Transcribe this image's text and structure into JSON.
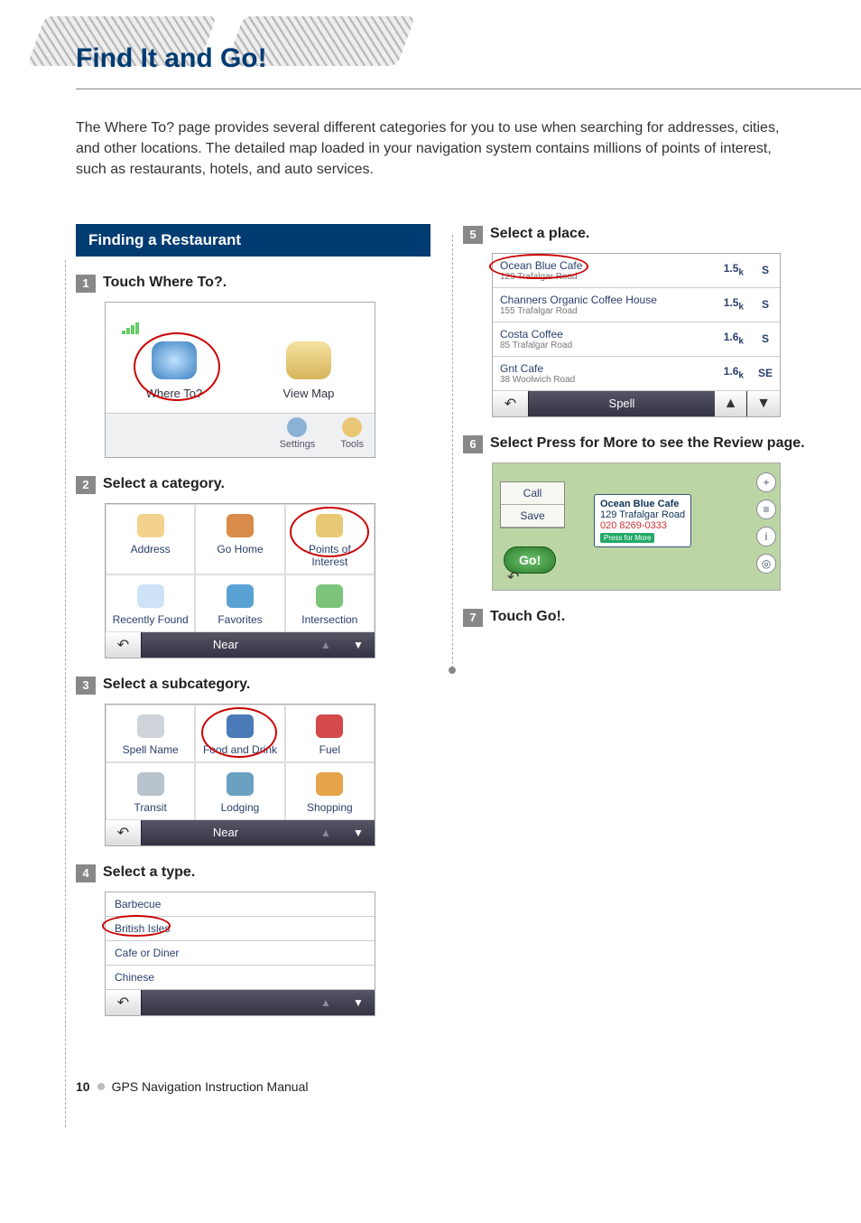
{
  "header": {
    "title": "Find It and Go!"
  },
  "intro": "The Where To? page provides several different categories for you to use when searching for addresses, cities, and other locations. The detailed map loaded in your navigation system contains millions of points of interest, such as restaurants, hotels, and auto services.",
  "left": {
    "section_title": "Finding a Restaurant",
    "steps": [
      {
        "num": "1",
        "text": "Touch Where To?."
      },
      {
        "num": "2",
        "text": "Select a category."
      },
      {
        "num": "3",
        "text": "Select a subcategory."
      },
      {
        "num": "4",
        "text": "Select a type."
      }
    ],
    "home": {
      "where_to": "Where To?",
      "view_map": "View Map",
      "settings": "Settings",
      "tools": "Tools"
    },
    "categories": {
      "address": "Address",
      "go_home": "Go Home",
      "poi": "Points of Interest",
      "recently": "Recently Found",
      "favorites": "Favorites",
      "intersection": "Intersection",
      "near": "Near"
    },
    "subcats": {
      "spell": "Spell Name",
      "food": "Food and Drink",
      "fuel": "Fuel",
      "transit": "Transit",
      "lodging": "Lodging",
      "shopping": "Shopping",
      "near": "Near"
    },
    "types": [
      "Barbecue",
      "British Isles",
      "Cafe or Diner",
      "Chinese"
    ]
  },
  "right": {
    "steps": [
      {
        "num": "5",
        "text": "Select a place."
      },
      {
        "num": "6",
        "text": " Select Press for More to see the Review page."
      },
      {
        "num": "7",
        "text": "Touch Go!."
      }
    ],
    "results": [
      {
        "name": "Ocean Blue Cafe",
        "addr": "129 Trafalgar Road",
        "dist": "1.5",
        "unit": "k",
        "dir": "S"
      },
      {
        "name": "Channers Organic Coffee House",
        "addr": "155 Trafalgar Road",
        "dist": "1.5",
        "unit": "k",
        "dir": "S"
      },
      {
        "name": "Costa Coffee",
        "addr": "85 Trafalgar Road",
        "dist": "1.6",
        "unit": "k",
        "dir": "S"
      },
      {
        "name": "Gnt Cafe",
        "addr": "38 Woolwich Road",
        "dist": "1.6",
        "unit": "k",
        "dir": "SE"
      }
    ],
    "results_toolbar": {
      "spell": "Spell"
    },
    "review": {
      "call": "Call",
      "save": "Save",
      "go": "Go!",
      "name": "Ocean Blue Cafe",
      "addr": "129 Trafalgar Road",
      "phone": "020 8269-0333",
      "press_more": "Press for More"
    }
  },
  "footer": {
    "page": "10",
    "doc": "GPS Navigation Instruction Manual"
  }
}
